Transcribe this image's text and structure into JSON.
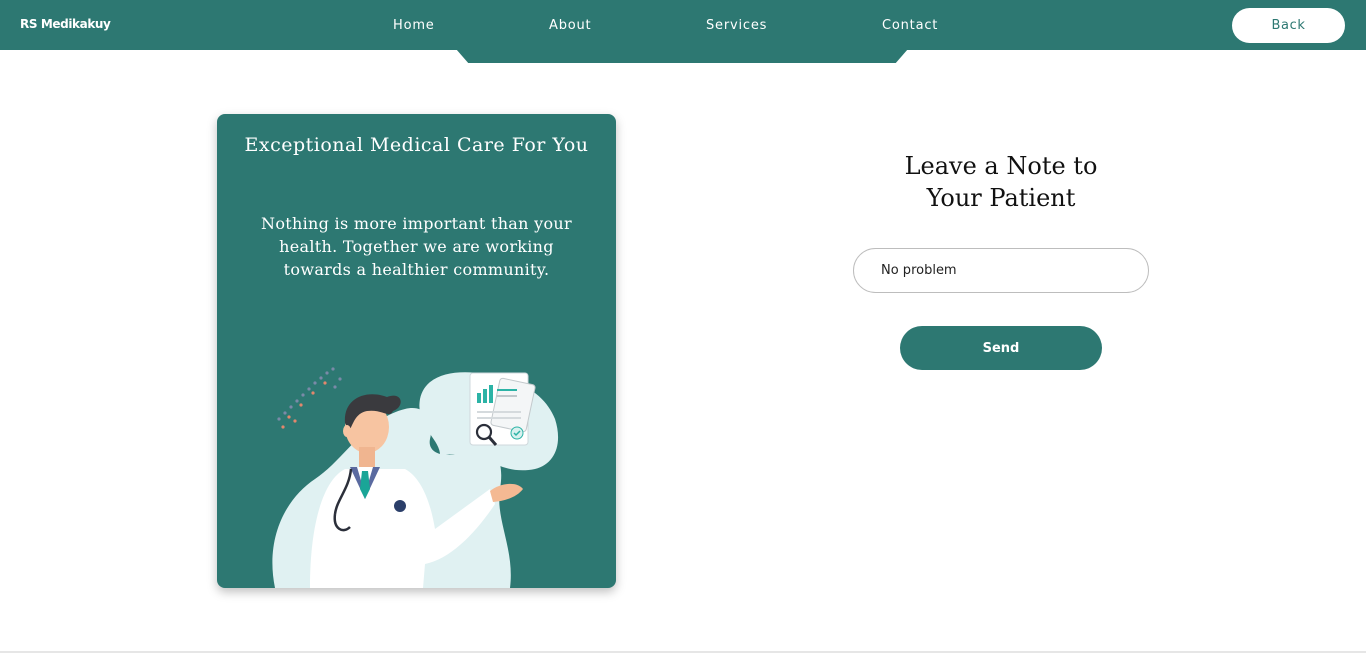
{
  "brand": "RS Medikakuy",
  "nav": {
    "home": "Home",
    "about": "About",
    "services": "Services",
    "contact": "Contact",
    "back": "Back"
  },
  "card": {
    "title": "Exceptional Medical Care For You",
    "text": "Nothing is more important than your health. Together we are working towards a healthier community."
  },
  "note": {
    "title_line1": "Leave a Note to",
    "title_line2": "Your Patient",
    "input_value": "No problem",
    "send_label": "Send"
  },
  "colors": {
    "primary": "#2d7872",
    "white": "#ffffff",
    "text_dark": "#111111"
  },
  "icons": [
    "doctor-illustration"
  ]
}
